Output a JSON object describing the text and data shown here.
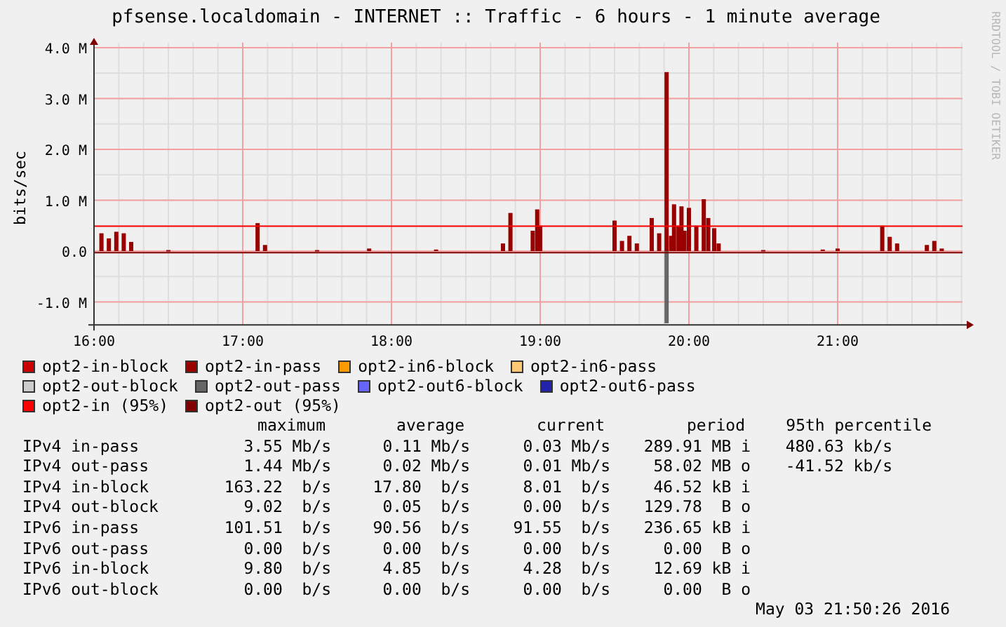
{
  "signature": "RRDTOOL / TOBI OETIKER",
  "chart_data": {
    "type": "bar",
    "title": "pfsense.localdomain - INTERNET :: Traffic - 6 hours - 1 minute average",
    "ylabel": "bits/sec",
    "xlim": [
      16,
      21.84
    ],
    "ylim": [
      -1.45,
      4.1
    ],
    "grid": true,
    "x": [
      16.05,
      16.1,
      16.15,
      16.2,
      16.25,
      16.5,
      17.1,
      17.15,
      17.5,
      17.85,
      18.3,
      18.75,
      18.8,
      18.95,
      18.98,
      19.0,
      19.5,
      19.55,
      19.6,
      19.65,
      19.75,
      19.8,
      19.85,
      19.88,
      19.9,
      19.93,
      19.95,
      19.97,
      20.0,
      20.05,
      20.1,
      20.13,
      20.17,
      20.2,
      20.5,
      20.9,
      21.0,
      21.3,
      21.35,
      21.4,
      21.6,
      21.65,
      21.7
    ],
    "series": [
      {
        "name": "opt2-in-block",
        "color": "#cc0000",
        "values": [
          null,
          null,
          null,
          null,
          null,
          null,
          null,
          null,
          null,
          null,
          null,
          null,
          null,
          null,
          null,
          null,
          null,
          null,
          null,
          null,
          null,
          null,
          null,
          null,
          null,
          null,
          null,
          null,
          null,
          null,
          null,
          null,
          null,
          null,
          null,
          null,
          null,
          null,
          null,
          null,
          null,
          null,
          null
        ]
      },
      {
        "name": "opt2-in-pass",
        "color": "#990000",
        "values": [
          0.35,
          0.25,
          0.38,
          0.35,
          0.18,
          0.02,
          0.55,
          0.12,
          0.02,
          0.05,
          0.03,
          0.15,
          0.75,
          0.4,
          0.82,
          0.5,
          0.6,
          0.2,
          0.3,
          0.15,
          0.65,
          0.35,
          3.52,
          0.3,
          0.92,
          0.5,
          0.88,
          0.4,
          0.85,
          0.5,
          1.02,
          0.65,
          0.45,
          0.15,
          0.02,
          0.03,
          0.05,
          0.5,
          0.28,
          0.15,
          0.12,
          0.2,
          0.05
        ]
      },
      {
        "name": "opt2-in6-block",
        "color": "#ff9900",
        "values": [
          null,
          null,
          null,
          null,
          null,
          null,
          null,
          null,
          null,
          null,
          null,
          null,
          null,
          null,
          null,
          null,
          null,
          null,
          null,
          null,
          null,
          null,
          null,
          null,
          null,
          null,
          null,
          null,
          null,
          null,
          null,
          null,
          null,
          null,
          null,
          null,
          null,
          null,
          null,
          null,
          null,
          null,
          null
        ]
      },
      {
        "name": "opt2-in6-pass",
        "color": "#ffc875",
        "values": [
          null,
          null,
          null,
          null,
          null,
          null,
          null,
          null,
          null,
          null,
          null,
          null,
          null,
          null,
          null,
          null,
          null,
          null,
          null,
          null,
          null,
          null,
          null,
          null,
          null,
          null,
          null,
          null,
          null,
          null,
          null,
          null,
          null,
          null,
          null,
          null,
          null,
          null,
          null,
          null,
          null,
          null,
          null
        ]
      },
      {
        "name": "opt2-out-block",
        "color": "#cccccc",
        "values": [
          null,
          null,
          null,
          null,
          null,
          null,
          null,
          null,
          null,
          null,
          null,
          null,
          null,
          null,
          null,
          null,
          null,
          null,
          null,
          null,
          null,
          null,
          null,
          null,
          null,
          null,
          null,
          null,
          null,
          null,
          null,
          null,
          null,
          null,
          null,
          null,
          null,
          null,
          null,
          null,
          null,
          null,
          null
        ]
      },
      {
        "name": "opt2-out-pass",
        "color": "#666666",
        "values": [
          null,
          null,
          null,
          null,
          null,
          null,
          null,
          null,
          null,
          null,
          null,
          null,
          null,
          null,
          null,
          null,
          null,
          null,
          null,
          null,
          null,
          null,
          -1.42,
          null,
          null,
          null,
          null,
          null,
          null,
          null,
          null,
          null,
          null,
          null,
          null,
          null,
          null,
          null,
          null,
          null,
          null,
          null,
          null
        ]
      },
      {
        "name": "opt2-out6-block",
        "color": "#6666ff",
        "values": [
          null,
          null,
          null,
          null,
          null,
          null,
          null,
          null,
          null,
          null,
          null,
          null,
          null,
          null,
          null,
          null,
          null,
          null,
          null,
          null,
          null,
          null,
          null,
          null,
          null,
          null,
          null,
          null,
          null,
          null,
          null,
          null,
          null,
          null,
          null,
          null,
          null,
          null,
          null,
          null,
          null,
          null,
          null
        ]
      },
      {
        "name": "opt2-out6-pass",
        "color": "#2222aa",
        "values": [
          null,
          null,
          null,
          null,
          null,
          null,
          null,
          null,
          null,
          null,
          null,
          null,
          null,
          null,
          null,
          null,
          null,
          null,
          null,
          null,
          null,
          null,
          null,
          null,
          null,
          null,
          null,
          null,
          null,
          null,
          null,
          null,
          null,
          null,
          null,
          null,
          null,
          null,
          null,
          null,
          null,
          null,
          null
        ]
      }
    ],
    "ref_lines": [
      {
        "axis": "y",
        "label": "opt2-in (95%)",
        "value": 0.49,
        "color": "#ff0000"
      },
      {
        "axis": "y",
        "label": "opt2-out (95%)",
        "value": -0.03,
        "color": "#7f0000"
      }
    ],
    "xticks": [
      {
        "value": 16,
        "label": "16:00"
      },
      {
        "value": 17,
        "label": "17:00"
      },
      {
        "value": 18,
        "label": "18:00"
      },
      {
        "value": 19,
        "label": "19:00"
      },
      {
        "value": 20,
        "label": "20:00"
      },
      {
        "value": 21,
        "label": "21:00"
      }
    ],
    "yticks": [
      {
        "value": 4,
        "label": "4.0 M"
      },
      {
        "value": 3,
        "label": "3.0 M"
      },
      {
        "value": 2,
        "label": "2.0 M"
      },
      {
        "value": 1,
        "label": "1.0 M"
      },
      {
        "value": 0,
        "label": "0.0"
      },
      {
        "value": -1,
        "label": "-1.0 M"
      }
    ]
  },
  "stats": {
    "columns": [
      "maximum",
      "average",
      "current",
      "period",
      "95th percentile"
    ],
    "rows": [
      {
        "label": "IPv4 in-pass",
        "maximum": "3.55 Mb/s",
        "average": "0.11 Mb/s",
        "current": "0.03 Mb/s",
        "period": "289.91 MB i",
        "percentile": "480.63 kb/s"
      },
      {
        "label": "IPv4 out-pass",
        "maximum": "1.44 Mb/s",
        "average": "0.02 Mb/s",
        "current": "0.01 Mb/s",
        "period": "58.02 MB o",
        "percentile": "-41.52 kb/s"
      },
      {
        "label": "IPv4 in-block",
        "maximum": "163.22  b/s",
        "average": "17.80  b/s",
        "current": "8.01  b/s",
        "period": "46.52 kB i"
      },
      {
        "label": "IPv4 out-block",
        "maximum": "9.02  b/s",
        "average": "0.05  b/s",
        "current": "0.00  b/s",
        "period": "129.78  B o"
      },
      {
        "label": "IPv6 in-pass",
        "maximum": "101.51  b/s",
        "average": "90.56  b/s",
        "current": "91.55  b/s",
        "period": "236.65 kB i"
      },
      {
        "label": "IPv6 out-pass",
        "maximum": "0.00  b/s",
        "average": "0.00  b/s",
        "current": "0.00  b/s",
        "period": "0.00  B o"
      },
      {
        "label": "IPv6 in-block",
        "maximum": "9.80  b/s",
        "average": "4.85  b/s",
        "current": "4.28  b/s",
        "period": "12.69 kB i"
      },
      {
        "label": "IPv6 out-block",
        "maximum": "0.00  b/s",
        "average": "0.00  b/s",
        "current": "0.00  b/s",
        "period": "0.00  B o"
      }
    ]
  },
  "timestamp": "May 03 21:50:26 2016"
}
